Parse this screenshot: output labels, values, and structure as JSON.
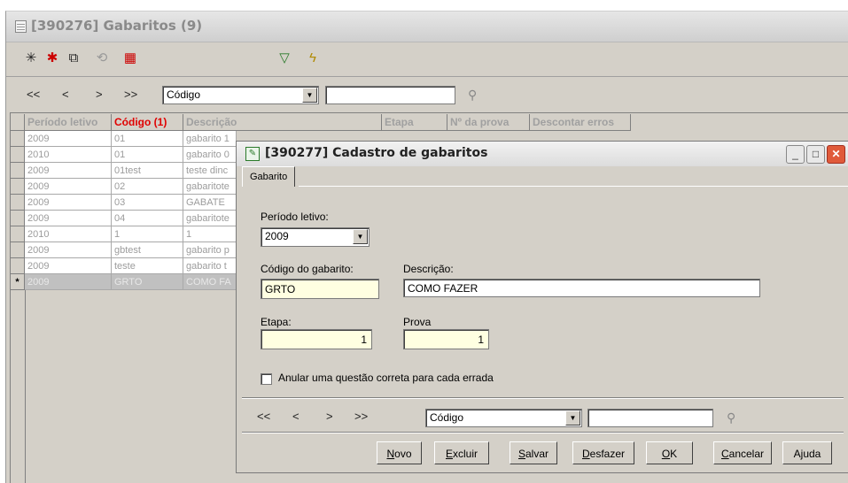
{
  "main": {
    "title": "[390276]  Gabaritos (9)",
    "nav": {
      "first": "<<",
      "prev": "<",
      "next": ">",
      "last": ">>"
    },
    "search_field": "Código",
    "search_value": "",
    "columns": [
      "Período letivo",
      "Código (1)",
      "Descrição",
      "Etapa",
      "Nº da prova",
      "Descontar erros"
    ],
    "rows": [
      [
        "2009",
        "01",
        "gabarito 1"
      ],
      [
        "2010",
        "01",
        "gabarito 0"
      ],
      [
        "2009",
        "01test",
        "teste dinc"
      ],
      [
        "2009",
        "02",
        "gabaritote"
      ],
      [
        "2009",
        "03",
        "GABATE"
      ],
      [
        "2009",
        "04",
        "gabaritote"
      ],
      [
        "2010",
        "1",
        "1"
      ],
      [
        "2009",
        "gbtest",
        "gabarito p"
      ],
      [
        "2009",
        "teste",
        "gabarito t"
      ],
      [
        "2009",
        "GRTO",
        "COMO FA"
      ]
    ],
    "current_row_marker": "*"
  },
  "dialog": {
    "title": "[390277]  Cadastro de gabaritos",
    "tab": "Gabarito",
    "periodo_label": "Período letivo:",
    "periodo_value": "2009",
    "codigo_label": "Código do gabarito:",
    "codigo_value": "GRTO",
    "descricao_label": "Descrição:",
    "descricao_value": "COMO FAZER",
    "etapa_label": "Etapa:",
    "etapa_value": "1",
    "prova_label": "Prova",
    "prova_value": "1",
    "anular_label": "Anular uma questão correta para cada errada",
    "nav": {
      "first": "<<",
      "prev": "<",
      "next": ">",
      "last": ">>"
    },
    "search_field": "Código",
    "search_value": "",
    "buttons": {
      "novo": {
        "u": "N",
        "rest": "ovo"
      },
      "excluir": {
        "u": "E",
        "rest": "xcluir"
      },
      "salvar": {
        "u": "S",
        "rest": "alvar"
      },
      "desfazer": {
        "u": "D",
        "rest": "esfazer"
      },
      "ok": {
        "u": "O",
        "rest": "K"
      },
      "cancelar": {
        "u": "C",
        "rest": "ancelar"
      },
      "ajuda": {
        "pre": "A",
        "u": "j",
        "rest": "uda"
      }
    }
  },
  "colors": {
    "active_header": "#e00000",
    "required_field": "#ffffe1",
    "close_button": "#e05a3a"
  }
}
